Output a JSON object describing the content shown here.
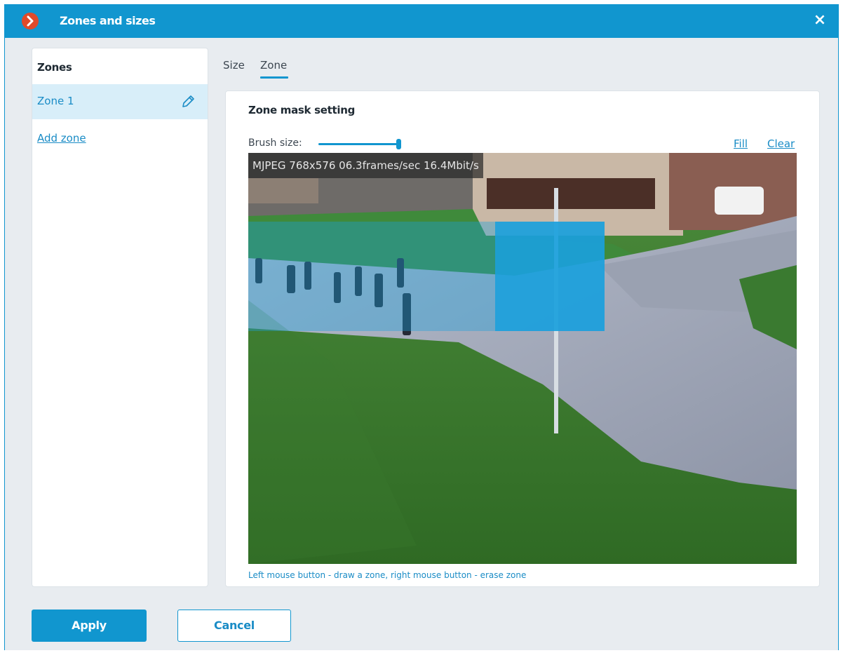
{
  "window": {
    "title": "Zones and sizes",
    "close_glyph": "×",
    "logo_icon": "chevron-right-icon"
  },
  "zones_panel": {
    "heading": "Zones",
    "items": [
      {
        "label": "Zone 1",
        "selected": true,
        "edit_icon": "pencil-icon"
      }
    ],
    "add_label": "Add zone"
  },
  "tabs": [
    {
      "label": "Size",
      "active": false
    },
    {
      "label": "Zone",
      "active": true
    }
  ],
  "mask": {
    "title": "Zone mask setting",
    "brush_label": "Brush size:",
    "brush_level": 1.0,
    "fill_label": "Fill",
    "clear_label": "Clear",
    "video_overlay": "MJPEG 768x576 06.3frames/sec 16.4Mbit/s",
    "hint": "Left mouse button - draw a zone, right mouse button - erase zone"
  },
  "buttons": {
    "apply": "Apply",
    "cancel": "Cancel"
  },
  "colors": {
    "accent": "#1196cf",
    "link": "#1a8cc6",
    "zone_mask": "#1aa0dc"
  }
}
